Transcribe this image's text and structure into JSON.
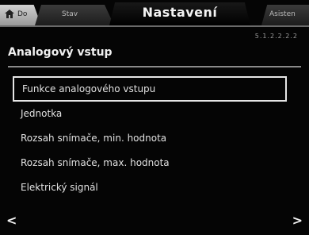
{
  "topbar": {
    "tabs": [
      {
        "label": "Do",
        "icon": "home-icon"
      },
      {
        "label": "Stav"
      },
      {
        "label": "Nastavení"
      },
      {
        "label": "Asisten"
      }
    ]
  },
  "header": {
    "page_indicator": "5.1.2.2.2.2",
    "title": "Analogový vstup"
  },
  "menu": {
    "items": [
      {
        "label": "Funkce analogového vstupu"
      },
      {
        "label": "Jednotka"
      },
      {
        "label": "Rozsah snímače, min. hodnota"
      },
      {
        "label": "Rozsah snímače, max. hodnota"
      },
      {
        "label": "Elektrický signál"
      }
    ],
    "selected_index": 0
  },
  "nav": {
    "prev_label": "<",
    "next_label": ">"
  }
}
